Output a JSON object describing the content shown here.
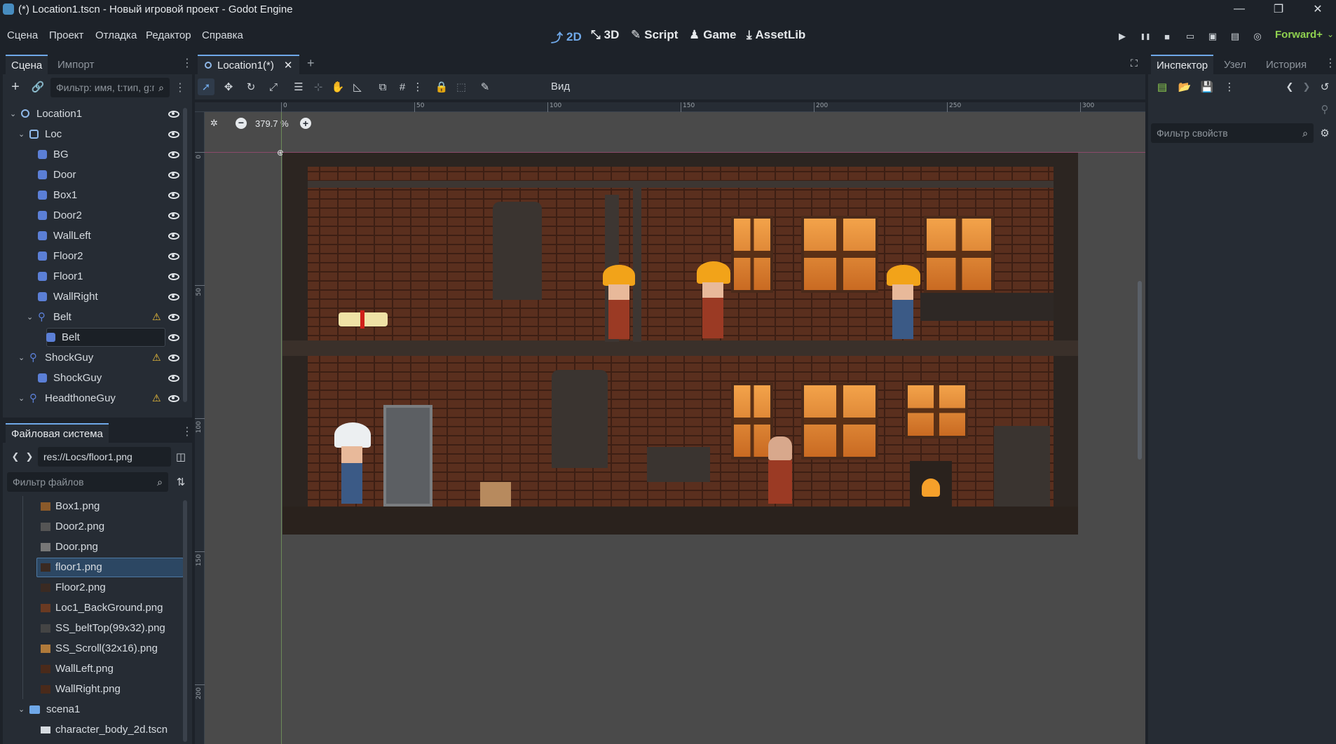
{
  "window": {
    "title": "(*) Location1.tscn - Новый игровой проект - Godot Engine",
    "minimize": "—",
    "maximize": "❐",
    "close": "✕"
  },
  "menu": {
    "items": [
      "Сцена",
      "Проект",
      "Отладка",
      "Редактор",
      "Справка"
    ]
  },
  "workspaces": {
    "items": [
      {
        "label": "2D",
        "icon": "2d-icon"
      },
      {
        "label": "3D",
        "icon": "3d-icon"
      },
      {
        "label": "Script",
        "icon": "script-icon"
      },
      {
        "label": "Game",
        "icon": "game-icon"
      },
      {
        "label": "AssetLib",
        "icon": "assetlib-icon"
      }
    ],
    "active": "2D"
  },
  "run": {
    "play": "▶",
    "pause": "❚❚",
    "stop": "■",
    "renderer": "Forward+"
  },
  "scene_dock": {
    "tabs": [
      "Сцена",
      "Импорт"
    ],
    "filter_placeholder": "Фильтр: имя, t:тип, g:гр",
    "tree": [
      {
        "label": "Location1",
        "depth": 0,
        "expanded": true,
        "icon": "node2d-icon",
        "warn": false
      },
      {
        "label": "Loc",
        "depth": 1,
        "expanded": true,
        "icon": "node-icon",
        "warn": false
      },
      {
        "label": "BG",
        "depth": 2,
        "icon": "sprite-icon",
        "warn": false
      },
      {
        "label": "Door",
        "depth": 2,
        "icon": "sprite-icon",
        "warn": false
      },
      {
        "label": "Box1",
        "depth": 2,
        "icon": "sprite-icon",
        "warn": false
      },
      {
        "label": "Door2",
        "depth": 2,
        "icon": "sprite-icon",
        "warn": false
      },
      {
        "label": "WallLeft",
        "depth": 2,
        "icon": "sprite-icon",
        "warn": false
      },
      {
        "label": "Floor2",
        "depth": 2,
        "icon": "sprite-icon",
        "warn": false
      },
      {
        "label": "Floor1",
        "depth": 2,
        "icon": "sprite-icon",
        "warn": false
      },
      {
        "label": "WallRight",
        "depth": 2,
        "icon": "sprite-icon",
        "warn": false
      },
      {
        "label": "Belt",
        "depth": 2,
        "expanded": true,
        "icon": "character-icon",
        "warn": true
      },
      {
        "label": "Belt",
        "depth": 3,
        "icon": "animated-sprite-icon",
        "warn": false,
        "selected": true
      },
      {
        "label": "ShockGuy",
        "depth": 1,
        "expanded": true,
        "icon": "character-icon",
        "warn": true
      },
      {
        "label": "ShockGuy",
        "depth": 2,
        "icon": "animated-sprite-icon",
        "warn": false
      },
      {
        "label": "HeadthoneGuy",
        "depth": 1,
        "expanded": true,
        "icon": "character-icon",
        "warn": true
      }
    ]
  },
  "filesystem": {
    "title": "Файловая система",
    "path": "res://Locs/floor1.png",
    "filter_placeholder": "Фильтр файлов",
    "files": [
      {
        "label": "Box1.png",
        "thumb": "#8a5a2a"
      },
      {
        "label": "Door2.png",
        "thumb": "#555555"
      },
      {
        "label": "Door.png",
        "thumb": "#777777"
      },
      {
        "label": "floor1.png",
        "thumb": "#3a2a22",
        "selected": true
      },
      {
        "label": "Floor2.png",
        "thumb": "#3a2a22"
      },
      {
        "label": "Loc1_BackGround.png",
        "thumb": "#6a3a22"
      },
      {
        "label": "SS_beltTop(99x32).png",
        "thumb": "#444444"
      },
      {
        "label": "SS_Scroll(32x16).png",
        "thumb": "#b07a3a"
      },
      {
        "label": "WallLeft.png",
        "thumb": "#4a2a1a"
      },
      {
        "label": "WallRight.png",
        "thumb": "#4a2a1a"
      }
    ],
    "folder": "scena1",
    "folder_file": "character_body_2d.tscn"
  },
  "editor": {
    "tab_label": "Location1(*)",
    "tab_close": "✕",
    "tab_add": "+",
    "view_menu": "Вид",
    "zoom": "379.7 %",
    "ruler_h": [
      "0",
      "50",
      "100",
      "150",
      "200",
      "250",
      "300"
    ],
    "ruler_v": [
      "0",
      "50",
      "100",
      "150",
      "200"
    ]
  },
  "inspector": {
    "tabs": [
      "Инспектор",
      "Узел",
      "История"
    ],
    "filter_placeholder": "Фильтр свойств"
  },
  "colors": {
    "accent": "#6fa8e8",
    "renderer": "#8fd14f",
    "warning": "#f0c23a"
  }
}
